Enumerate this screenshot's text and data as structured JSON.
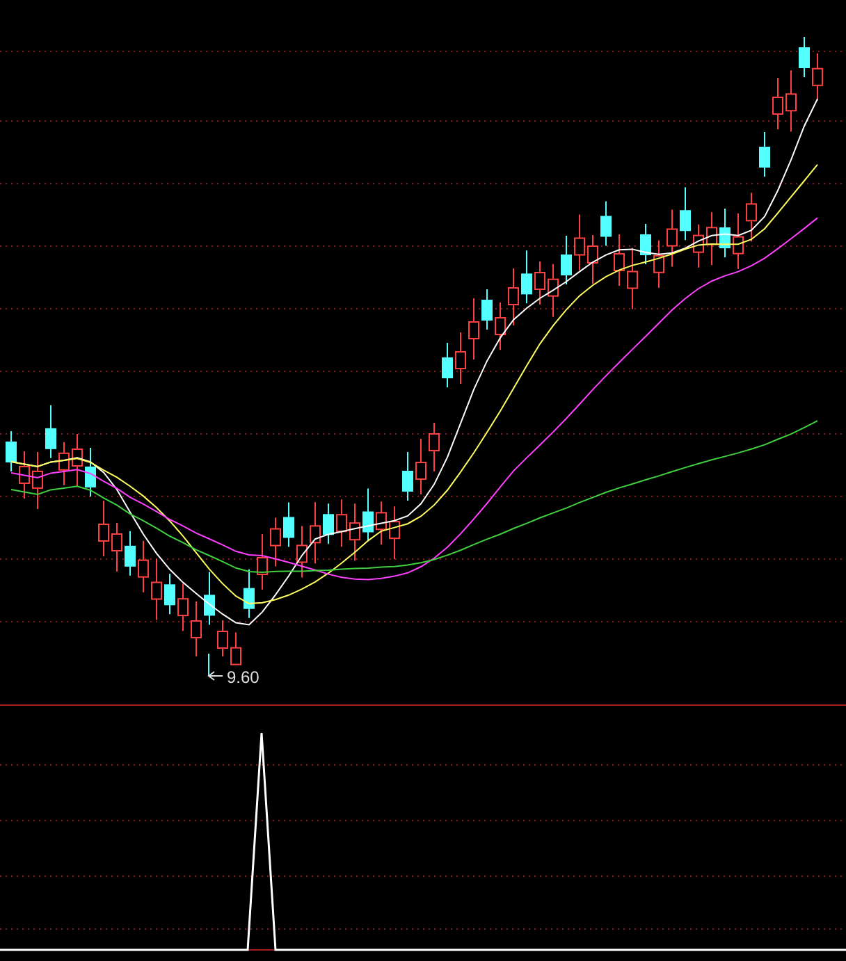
{
  "price_chart": {
    "low_label": "9.60"
  }
}
